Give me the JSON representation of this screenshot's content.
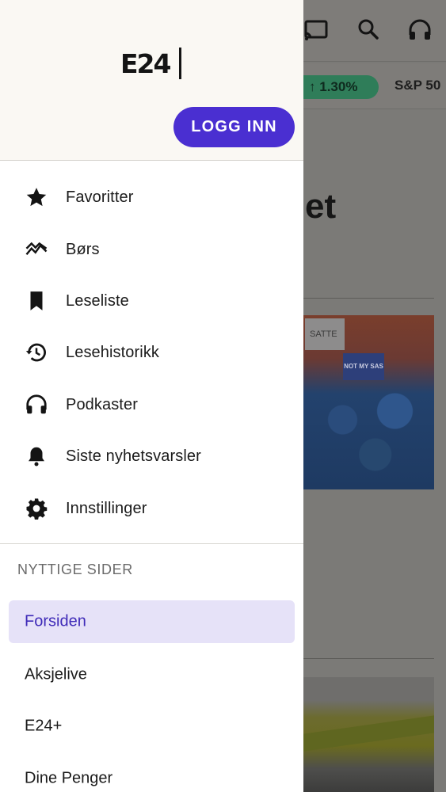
{
  "background": {
    "ticker_change": "1.30%",
    "ticker_index": "S&P 50",
    "headline_fragment": "et",
    "photo1_sign_left": "SATTE",
    "photo1_sign_mid": "NOT MY SAS"
  },
  "drawer": {
    "logo": "E24",
    "login_label": "LOGG INN",
    "menu": [
      {
        "label": "Favoritter",
        "icon": "star-icon"
      },
      {
        "label": "Børs",
        "icon": "stock-chart-icon"
      },
      {
        "label": "Leseliste",
        "icon": "bookmark-icon"
      },
      {
        "label": "Lesehistorikk",
        "icon": "history-icon"
      },
      {
        "label": "Podkaster",
        "icon": "headphones-icon"
      },
      {
        "label": "Siste nyhetsvarsler",
        "icon": "bell-icon"
      },
      {
        "label": "Innstillinger",
        "icon": "gear-icon"
      }
    ],
    "section_title": "NYTTIGE SIDER",
    "links": [
      {
        "label": "Forsiden",
        "active": true
      },
      {
        "label": "Aksjelive",
        "active": false
      },
      {
        "label": "E24+",
        "active": false
      },
      {
        "label": "Dine Penger",
        "active": false
      }
    ]
  },
  "colors": {
    "accent": "#4a2fd1",
    "active_bg": "#e6e2f8",
    "header_bg": "#faf8f3",
    "scrim": "#7b7a77",
    "ticker_green": "#2f7d59"
  }
}
